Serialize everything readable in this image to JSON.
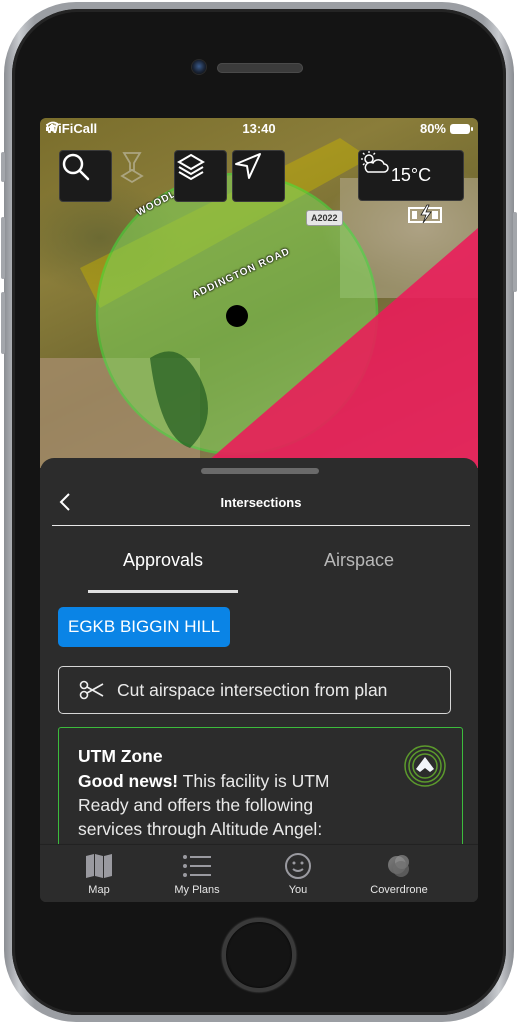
{
  "status_bar": {
    "carrier": "WiFiCall",
    "time": "13:40",
    "battery": "80%"
  },
  "map": {
    "toolbar": [
      {
        "name": "search",
        "icon": "search-icon"
      },
      {
        "name": "altitude",
        "icon": "hourglass-pin-icon"
      },
      {
        "name": "layers",
        "icon": "layers-icon"
      },
      {
        "name": "locate",
        "icon": "location-arrow-icon"
      }
    ],
    "weather": {
      "icon": "partly-cloudy-icon",
      "temperature": "15°C"
    },
    "drone_battery_icon": "battery-charging-icon",
    "labels": {
      "road_1": "ADDINGTON ROAD",
      "road_2": "WOODL",
      "road_badge": "A2022"
    },
    "colors": {
      "flight_area": "#3ee83e",
      "restricted_zone": "#ec1a5a",
      "caution_zone": "#c8b400"
    }
  },
  "sheet": {
    "title": "Intersections",
    "back_icon": "chevron-left-icon",
    "tabs": [
      {
        "label": "Approvals",
        "active": true
      },
      {
        "label": "Airspace",
        "active": false
      }
    ],
    "airport_badge": "EGKB BIGGIN HILL",
    "cut_button": {
      "icon": "scissors-icon",
      "label": "Cut airspace intersection from plan"
    },
    "utm_card": {
      "title": "UTM Zone",
      "lead": "Good news!",
      "body": " This facility is UTM Ready and offers the following services through Altitude Angel:",
      "icon": "altitude-angel-logo-icon"
    },
    "colors": {
      "badge": "#0a84e6",
      "card_border": "#3cbc3c"
    }
  },
  "tab_bar": [
    {
      "label": "Map",
      "icon": "map-icon"
    },
    {
      "label": "My Plans",
      "icon": "list-icon"
    },
    {
      "label": "You",
      "icon": "smiley-icon"
    },
    {
      "label": "Coverdrone",
      "icon": "coverdrone-logo-icon"
    }
  ]
}
